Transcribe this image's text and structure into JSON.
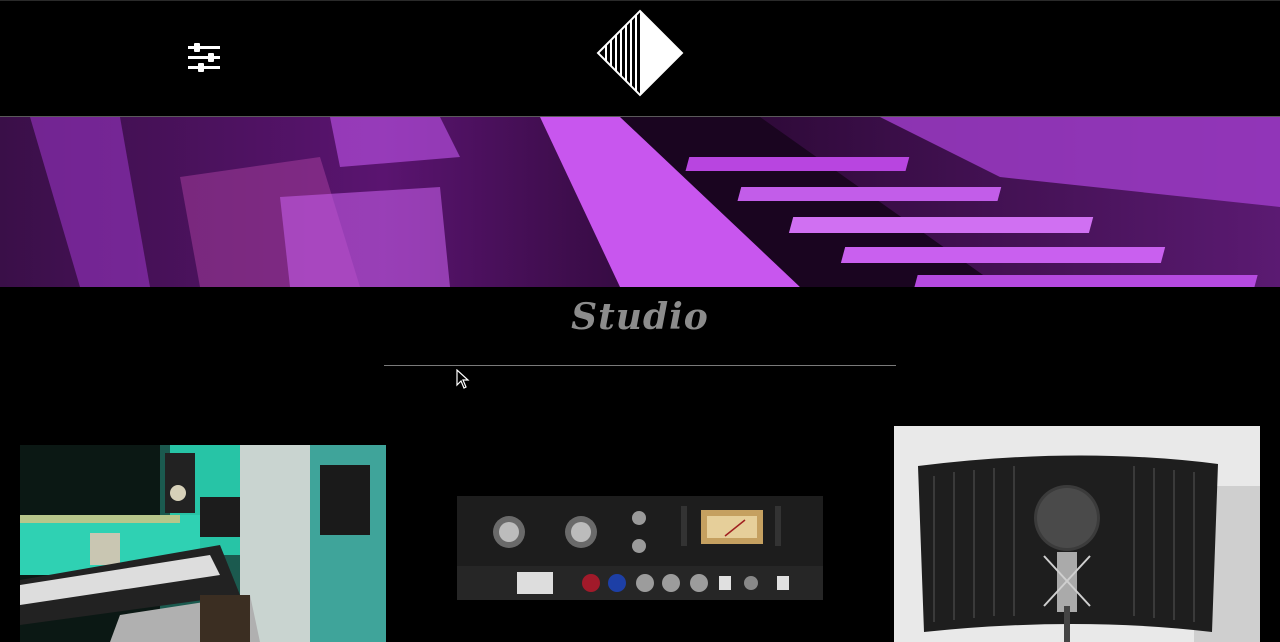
{
  "header": {
    "menu_icon": "sliders-menu-icon",
    "logo": "diamond-logo"
  },
  "hero": {
    "image": "purple-keyboard-banner"
  },
  "section": {
    "title": "Studio"
  },
  "gallery": {
    "items": [
      {
        "image": "studio-desk-photo"
      },
      {
        "image": "rack-compressor-photo"
      },
      {
        "image": "vocal-booth-microphone-photo"
      }
    ]
  },
  "colors": {
    "background": "#000000",
    "title": "#8c8c8c",
    "hero_purple": "#b13ee0",
    "studio_teal": "#2fd1b3"
  }
}
